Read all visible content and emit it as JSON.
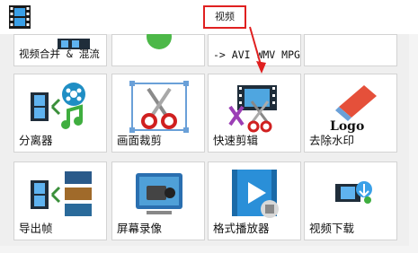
{
  "window": {
    "title": "视频"
  },
  "tiles": [
    {
      "label": "视频合并 & 混流"
    },
    {
      "label": ""
    },
    {
      "label": "-> AVI WMV MPG ...."
    },
    {
      "label": ""
    },
    {
      "label": "分离器"
    },
    {
      "label": "画面裁剪"
    },
    {
      "label": "快速剪辑"
    },
    {
      "label": "去除水印",
      "logo_text": "Logo"
    },
    {
      "label": "导出帧"
    },
    {
      "label": "屏幕录像"
    },
    {
      "label": "格式播放器"
    },
    {
      "label": "视频下载"
    }
  ],
  "icons": {
    "app": "film-strip-icon",
    "arrow": "red-arrow-icon"
  },
  "colors": {
    "highlight": "#e02020",
    "panel_bg": "#efefef",
    "tile_border": "#d3d3d3"
  }
}
